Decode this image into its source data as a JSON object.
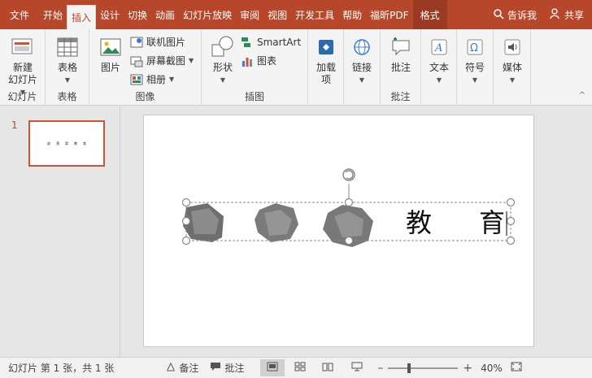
{
  "tabs": [
    {
      "label": "文件"
    },
    {
      "label": "开始"
    },
    {
      "label": "插入"
    },
    {
      "label": "设计"
    },
    {
      "label": "切换"
    },
    {
      "label": "动画"
    },
    {
      "label": "幻灯片放映"
    },
    {
      "label": "审阅"
    },
    {
      "label": "视图"
    },
    {
      "label": "开发工具"
    },
    {
      "label": "帮助"
    },
    {
      "label": "福昕PDF"
    },
    {
      "label": "格式"
    }
  ],
  "tell_me": "告诉我",
  "share": "共享",
  "ribbon": {
    "slides_group": {
      "label": "幻灯片",
      "new_slide": "新建\n幻灯片"
    },
    "tables_group": {
      "label": "表格",
      "table": "表格"
    },
    "images_group": {
      "label": "图像",
      "picture": "图片",
      "online_picture": "联机图片",
      "screenshot": "屏幕截图",
      "album": "相册"
    },
    "illustrations_group": {
      "label": "插图",
      "shapes": "形状",
      "smartart": "SmartArt",
      "chart": "图表"
    },
    "addins": "加载\n项",
    "links": "链接",
    "comments_group": {
      "label": "批注",
      "comment": "批注"
    },
    "text": "文本",
    "symbols": "符号",
    "media": "媒体"
  },
  "thumbnail": {
    "number": "1",
    "chars": [
      "部",
      "落",
      "窝",
      "教",
      "育"
    ]
  },
  "slide": {
    "char1": "教",
    "char2": "育"
  },
  "status": {
    "slide_info": "幻灯片 第 1 张，共 1 张",
    "notes": "备注",
    "comments": "批注",
    "zoom": "40%"
  },
  "colors": {
    "accent": "#b7472a",
    "selection": "#d35230"
  }
}
